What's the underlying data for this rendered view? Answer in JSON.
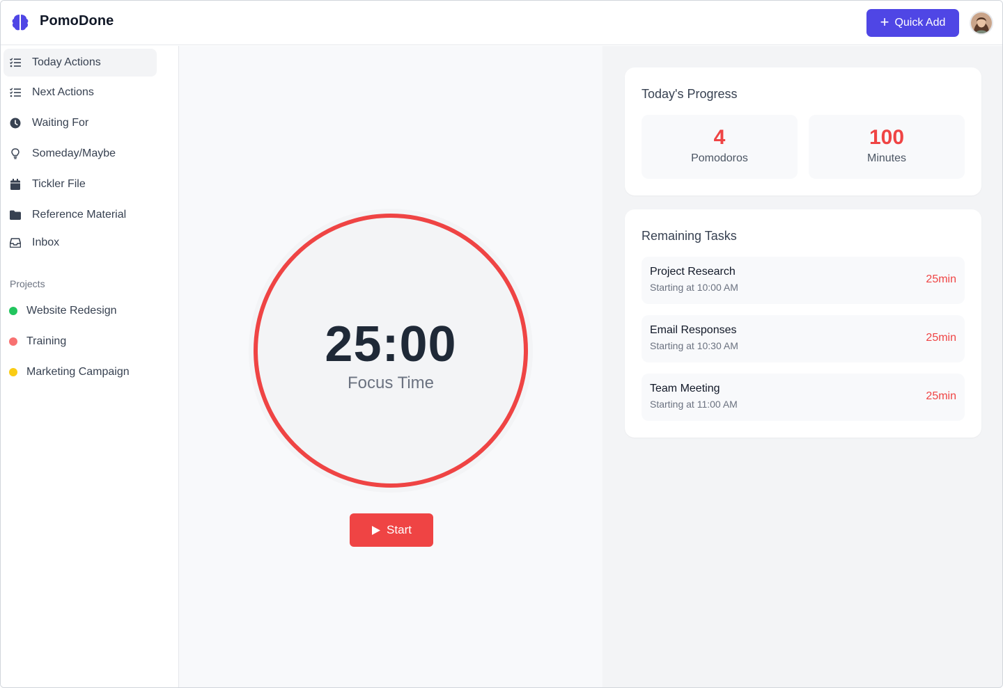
{
  "app": {
    "title": "PomoDone",
    "logo_icon": "brain-icon"
  },
  "header": {
    "quick_add_label": "Quick Add",
    "quick_add_icon": "plus-icon",
    "avatar": "user-avatar"
  },
  "sidebar": {
    "items": [
      {
        "label": "Today Actions",
        "icon": "checklist-icon",
        "active": true
      },
      {
        "label": "Next Actions",
        "icon": "checklist-icon",
        "active": false
      },
      {
        "label": "Waiting For",
        "icon": "clock-icon",
        "active": false
      },
      {
        "label": "Someday/Maybe",
        "icon": "lightbulb-icon",
        "active": false
      },
      {
        "label": "Tickler File",
        "icon": "calendar-icon",
        "active": false
      },
      {
        "label": "Reference Material",
        "icon": "folder-icon",
        "active": false
      },
      {
        "label": "Inbox",
        "icon": "inbox-icon",
        "active": false
      }
    ],
    "projects_title": "Projects",
    "projects": [
      {
        "label": "Website Redesign",
        "color": "#22c55e"
      },
      {
        "label": "Training",
        "color": "#f87171"
      },
      {
        "label": "Marketing Campaign",
        "color": "#facc15"
      }
    ]
  },
  "timer": {
    "time": "25:00",
    "mode": "Focus Time",
    "start_label": "Start",
    "start_icon": "play-icon",
    "ring_color": "#ef4444",
    "progress": 1.0
  },
  "progress": {
    "title": "Today's Progress",
    "stats": [
      {
        "value": "4",
        "label": "Pomodoros"
      },
      {
        "value": "100",
        "label": "Minutes"
      }
    ]
  },
  "tasks": {
    "title": "Remaining Tasks",
    "items": [
      {
        "name": "Project Research",
        "time": "Starting at 10:00 AM",
        "duration": "25min"
      },
      {
        "name": "Email Responses",
        "time": "Starting at 10:30 AM",
        "duration": "25min"
      },
      {
        "name": "Team Meeting",
        "time": "Starting at 11:00 AM",
        "duration": "25min"
      }
    ]
  },
  "colors": {
    "accent": "#4f46e5",
    "danger": "#ef4444"
  }
}
